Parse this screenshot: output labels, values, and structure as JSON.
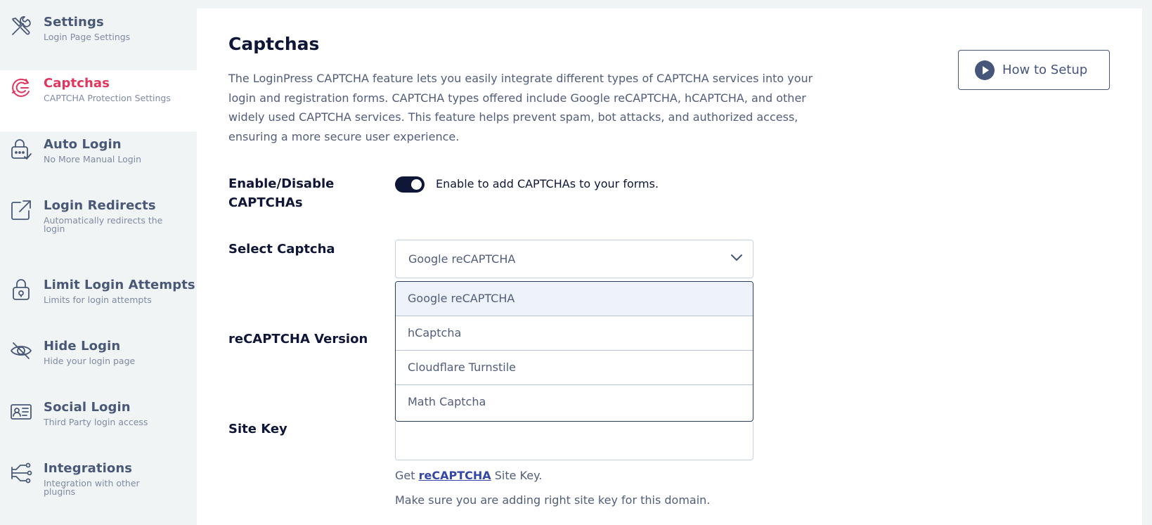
{
  "sidebar": {
    "items": [
      {
        "title": "Settings",
        "subtitle": "Login Page Settings",
        "icon": "tools-icon",
        "active": false
      },
      {
        "title": "Captchas",
        "subtitle": "CAPTCHA Protection Settings",
        "icon": "captcha-icon",
        "active": true
      },
      {
        "title": "Auto Login",
        "subtitle": "No More Manual Login",
        "icon": "lock-check-icon",
        "active": false
      },
      {
        "title": "Login Redirects",
        "subtitle": "Automatically redirects the login",
        "icon": "external-link-icon",
        "active": false
      },
      {
        "title": "Limit Login Attempts",
        "subtitle": "Limits for login attempts",
        "icon": "padlock-icon",
        "active": false
      },
      {
        "title": "Hide Login",
        "subtitle": "Hide your login page",
        "icon": "eye-off-icon",
        "active": false
      },
      {
        "title": "Social Login",
        "subtitle": "Third Party login access",
        "icon": "id-card-icon",
        "active": false
      },
      {
        "title": "Integrations",
        "subtitle": "Integration with other plugins",
        "icon": "integrations-icon",
        "active": false
      }
    ]
  },
  "main": {
    "title": "Captchas",
    "description": "The LoginPress CAPTCHA feature lets you easily integrate different types of CAPTCHA services into your login and registration forms. CAPTCHA types offered include Google reCAPTCHA, hCAPTCHA, and other widely used CAPTCHA services. This feature helps prevent spam, bot attacks, and authorized access, ensuring a more secure user experience.",
    "how_to_button": {
      "label": "How to Setup",
      "icon": "play-icon"
    },
    "enable": {
      "label": "Enable/Disable CAPTCHAs",
      "toggle_on": true,
      "help": "Enable to add CAPTCHAs to your forms."
    },
    "select_captcha": {
      "label": "Select Captcha",
      "value": "Google reCAPTCHA",
      "options": [
        "Google reCAPTCHA",
        "hCaptcha",
        "Cloudflare Turnstile",
        "Math Captcha"
      ]
    },
    "recaptcha_version": {
      "label": "reCAPTCHA Version"
    },
    "site_key": {
      "label": "Site Key",
      "value": "",
      "help_prefix": "Get",
      "help_link": "reCAPTCHA",
      "help_suffix": "Site Key.",
      "note": "Make sure you are adding right site key for this domain."
    }
  },
  "colors": {
    "accent_active": "#e2355d",
    "navy": "#0f1637",
    "muted_text": "#515d7a",
    "link": "#3446a6",
    "sidebar_bg": "#f1f4f5"
  }
}
